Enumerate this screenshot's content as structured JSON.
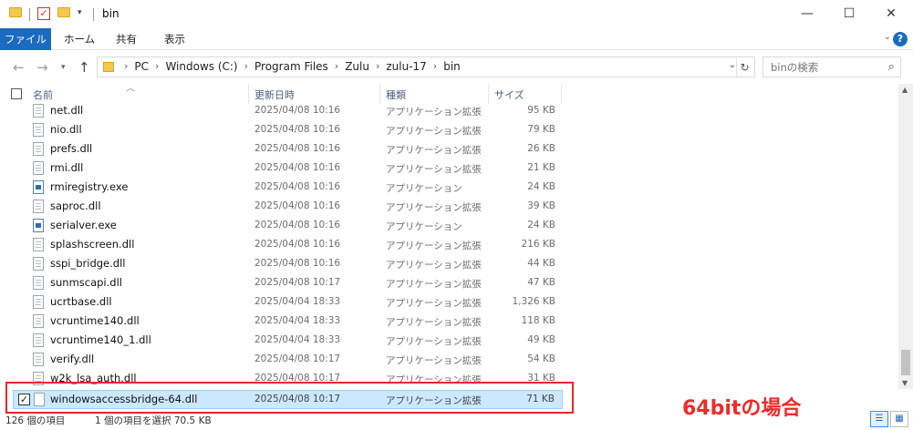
{
  "window": {
    "title": "bin",
    "minimize": "—",
    "maximize": "☐",
    "close": "✕"
  },
  "ribbon": {
    "tabs": [
      "ファイル",
      "ホーム",
      "共有",
      "表示"
    ],
    "expand": "⌄",
    "help": "?"
  },
  "address": {
    "crumbs": [
      "PC",
      "Windows (C:)",
      "Program Files",
      "Zulu",
      "zulu-17",
      "bin"
    ],
    "search_placeholder": "binの検索"
  },
  "columns": {
    "name": "名前",
    "date": "更新日時",
    "type": "種類",
    "size": "サイズ"
  },
  "files": [
    {
      "name": "net.dll",
      "date": "2025/04/08 10:16",
      "type": "アプリケーション拡張",
      "size": "95 KB",
      "icon": "dll"
    },
    {
      "name": "nio.dll",
      "date": "2025/04/08 10:16",
      "type": "アプリケーション拡張",
      "size": "79 KB",
      "icon": "dll"
    },
    {
      "name": "prefs.dll",
      "date": "2025/04/08 10:16",
      "type": "アプリケーション拡張",
      "size": "26 KB",
      "icon": "dll"
    },
    {
      "name": "rmi.dll",
      "date": "2025/04/08 10:16",
      "type": "アプリケーション拡張",
      "size": "21 KB",
      "icon": "dll"
    },
    {
      "name": "rmiregistry.exe",
      "date": "2025/04/08 10:16",
      "type": "アプリケーション",
      "size": "24 KB",
      "icon": "exe"
    },
    {
      "name": "saproc.dll",
      "date": "2025/04/08 10:16",
      "type": "アプリケーション拡張",
      "size": "39 KB",
      "icon": "dll"
    },
    {
      "name": "serialver.exe",
      "date": "2025/04/08 10:16",
      "type": "アプリケーション",
      "size": "24 KB",
      "icon": "exe"
    },
    {
      "name": "splashscreen.dll",
      "date": "2025/04/08 10:16",
      "type": "アプリケーション拡張",
      "size": "216 KB",
      "icon": "dll"
    },
    {
      "name": "sspi_bridge.dll",
      "date": "2025/04/08 10:16",
      "type": "アプリケーション拡張",
      "size": "44 KB",
      "icon": "dll"
    },
    {
      "name": "sunmscapi.dll",
      "date": "2025/04/08 10:17",
      "type": "アプリケーション拡張",
      "size": "47 KB",
      "icon": "dll"
    },
    {
      "name": "ucrtbase.dll",
      "date": "2025/04/04 18:33",
      "type": "アプリケーション拡張",
      "size": "1,326 KB",
      "icon": "dll"
    },
    {
      "name": "vcruntime140.dll",
      "date": "2025/04/04 18:33",
      "type": "アプリケーション拡張",
      "size": "118 KB",
      "icon": "dll"
    },
    {
      "name": "vcruntime140_1.dll",
      "date": "2025/04/04 18:33",
      "type": "アプリケーション拡張",
      "size": "49 KB",
      "icon": "dll"
    },
    {
      "name": "verify.dll",
      "date": "2025/04/08 10:17",
      "type": "アプリケーション拡張",
      "size": "54 KB",
      "icon": "dll"
    },
    {
      "name": "w2k_lsa_auth.dll",
      "date": "2025/04/08 10:17",
      "type": "アプリケーション拡張",
      "size": "31 KB",
      "icon": "dll"
    }
  ],
  "selected_file": {
    "name": "windowsaccessbridge-64.dll",
    "date": "2025/04/08 10:17",
    "type": "アプリケーション拡張",
    "size": "71 KB"
  },
  "annotation": "64bitの場合",
  "status": {
    "item_count": "126 個の項目",
    "selection": "1 個の項目を選択  70.5 KB"
  }
}
